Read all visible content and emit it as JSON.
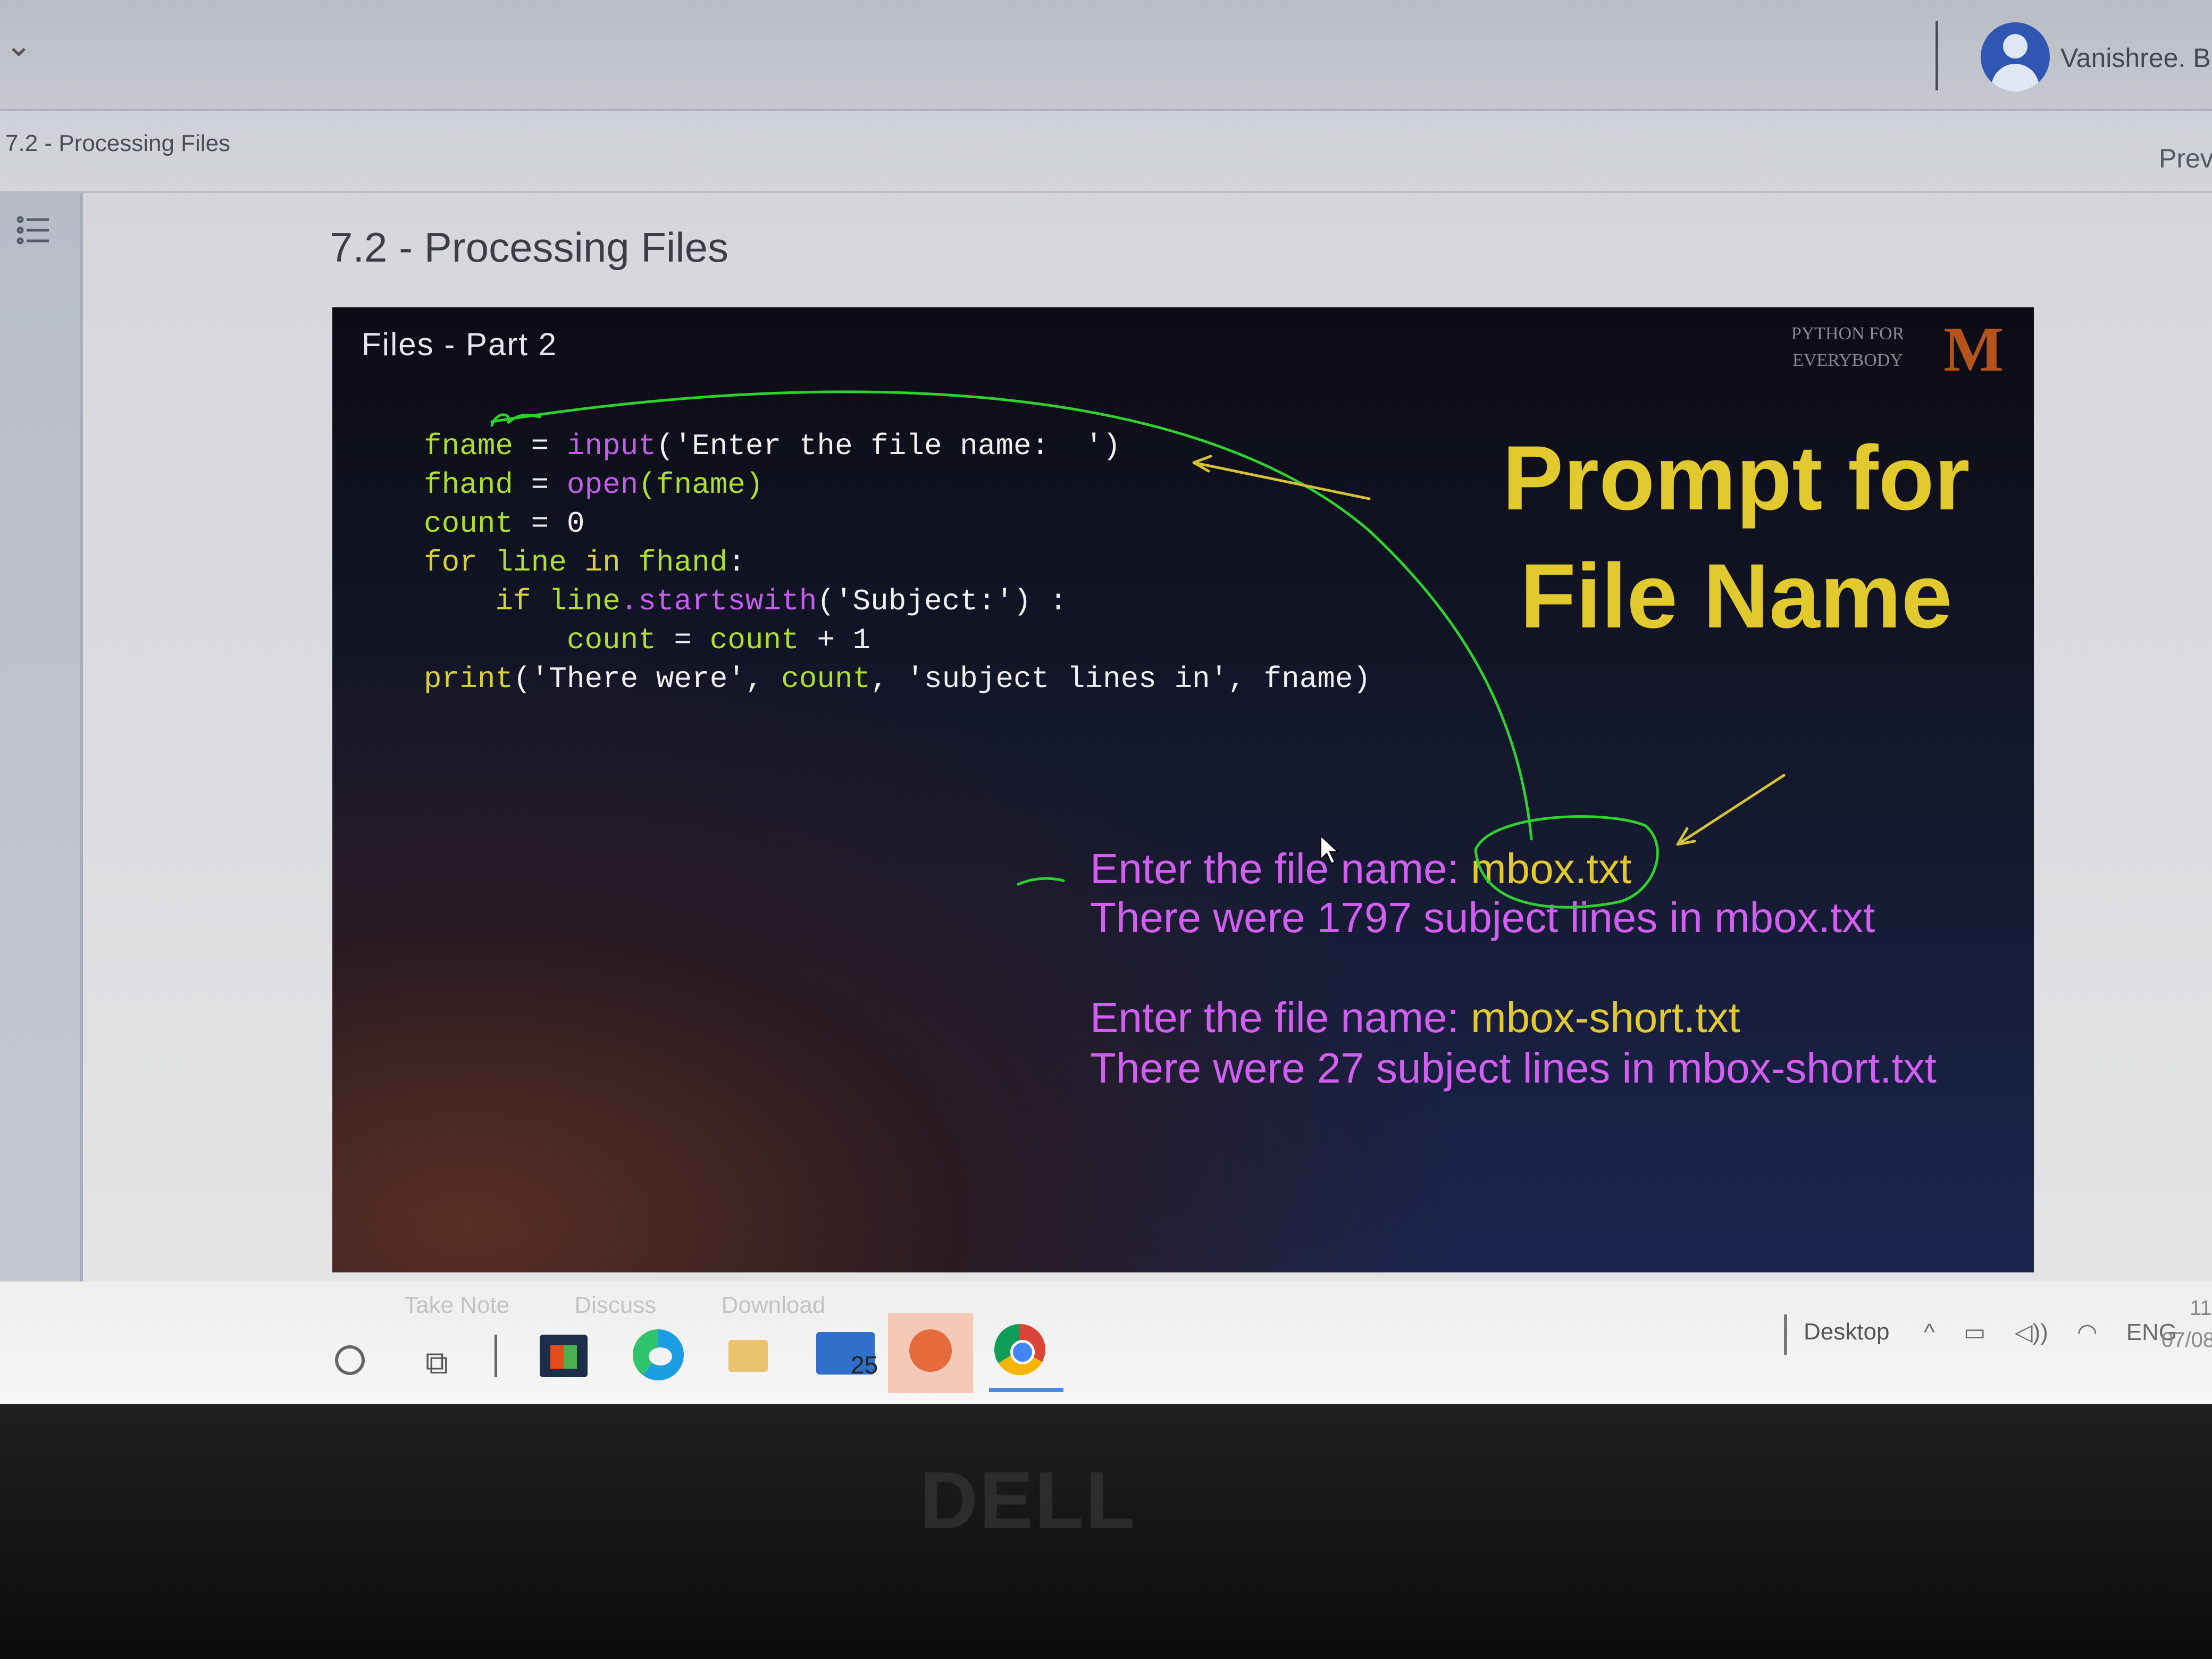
{
  "user": {
    "name": "Vanishree. Bi"
  },
  "breadcrumb": "7.2 - Processing Files",
  "nav": {
    "prev_label": "Prev"
  },
  "page_title": "7.2 - Processing Files",
  "slide": {
    "heading": "Files - Part 2",
    "brand": {
      "line1": "PYTHON FOR",
      "line2": "EVERYBODY",
      "logo": "M"
    },
    "prompt_label": {
      "line1": "Prompt for",
      "line2": "File Name"
    },
    "code": {
      "l1": {
        "var": "fname",
        "op": " = ",
        "fn": "input",
        "str": "('Enter the file name:  ')"
      },
      "l2": {
        "var": "fhand",
        "op": " = ",
        "fn": "open",
        "arg": "(fname)"
      },
      "l3": {
        "var": "count",
        "rest": " = 0"
      },
      "l4": {
        "kw": "for",
        "var1": "line",
        "kw2": "in",
        "var2": "fhand",
        "rest": ":"
      },
      "l5": {
        "kw": "if",
        "var": "line",
        "dot": ".",
        "fn": "startswith",
        "str": "('Subject:')",
        "rest": " :"
      },
      "l6": {
        "var1": "count",
        "op": " = ",
        "var2": "count",
        "rest": " + 1"
      },
      "l7": {
        "kw": "print",
        "str1": "('There were', ",
        "var": "count",
        "str2": ", 'subject lines in', fname)"
      }
    },
    "output": [
      {
        "label": "Enter the file name: ",
        "value": "mbox.txt"
      },
      {
        "label": "There were 1797 subject lines in mbox.txt"
      },
      {
        "label": "Enter the file name: ",
        "value": "mbox-short.txt"
      },
      {
        "label": "There were 27 subject lines in mbox-short.txt"
      }
    ]
  },
  "faded_actions": [
    "Take Note",
    "Discuss",
    "Download"
  ],
  "taskbar": {
    "mail_badge": "25",
    "desktop_label": "Desktop",
    "tray_language": "ENG",
    "clock_time": "11",
    "clock_date": "07/08"
  },
  "laptop_brand": "DELL",
  "colors": {
    "code_keyword": "#d6d13a",
    "code_function": "#c65cf0",
    "code_variable": "#aede2e",
    "prompt_label": "#e2c92d",
    "output_text": "#d25ff1",
    "annotation": "#2fd12f"
  }
}
